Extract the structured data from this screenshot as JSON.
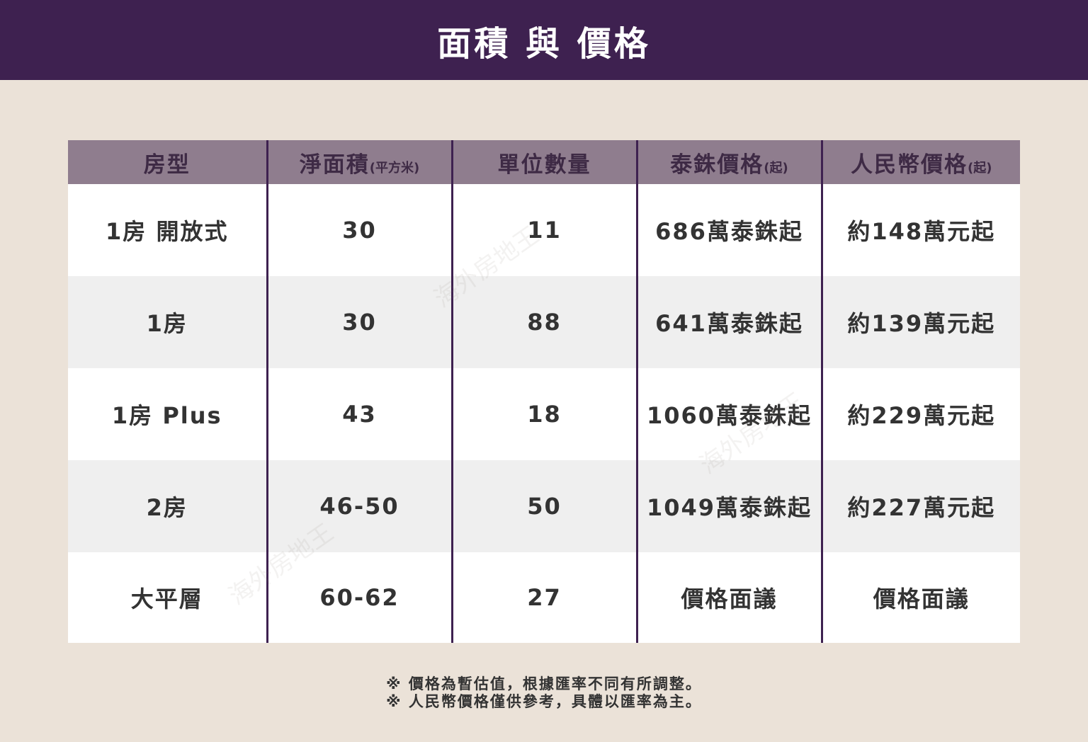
{
  "title": "面積 與 價格",
  "table": {
    "headers": [
      {
        "main": "房型",
        "unit": ""
      },
      {
        "main": "淨面積",
        "unit": "(平方米)"
      },
      {
        "main": "單位數量",
        "unit": ""
      },
      {
        "main": "泰銖價格",
        "unit": "(起)"
      },
      {
        "main": "人民幣價格",
        "unit": "(起)"
      }
    ],
    "rows": [
      [
        "1房 開放式",
        "30",
        "11",
        "686萬泰銖起",
        "約148萬元起"
      ],
      [
        "1房",
        "30",
        "88",
        "641萬泰銖起",
        "約139萬元起"
      ],
      [
        "1房 Plus",
        "43",
        "18",
        "1060萬泰銖起",
        "約229萬元起"
      ],
      [
        "2房",
        "46-50",
        "50",
        "1049萬泰銖起",
        "約227萬元起"
      ],
      [
        "大平層",
        "60-62",
        "27",
        "價格面議",
        "價格面議"
      ]
    ]
  },
  "notes": [
    "※ 價格為暫估值，根據匯率不同有所調整。",
    "※ 人民幣價格僅供參考，具體以匯率為主。"
  ],
  "watermark": "海外房地王"
}
